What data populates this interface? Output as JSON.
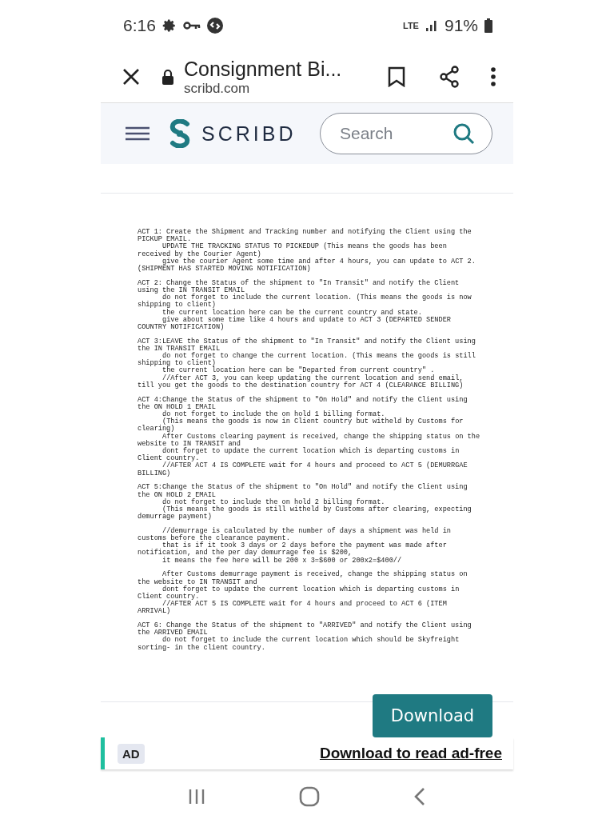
{
  "status_bar": {
    "time": "6:16",
    "network": "LTE",
    "battery": "91%"
  },
  "browser": {
    "title": "Consignment Bi...",
    "url": "scribd.com"
  },
  "site_header": {
    "logo": "SCRIBD",
    "search": {
      "placeholder": "Search"
    }
  },
  "document": {
    "paragraphs": [
      {
        "lines": [
          {
            "text": "ACT 1: Create the Shipment and Tracking number and notifying the Client using the",
            "indent": false
          },
          {
            "text": "PICKUP EMAIL.",
            "indent": false
          },
          {
            "text": "UPDATE THE TRACKING STATUS TO PICKEDUP (This means the goods has been",
            "indent": true
          },
          {
            "text": "received by the Courier Agent)",
            "indent": false
          },
          {
            "text": "give the courier Agent some time and after 4 hours, you can update to ACT 2.",
            "indent": true
          },
          {
            "text": "(SHIPMENT HAS STARTED MOVING NOTIFICATION)",
            "indent": false
          }
        ]
      },
      {
        "lines": [
          {
            "text": "ACT 2: Change the Status of the shipment to \"In Transit\" and notify the Client",
            "indent": false
          },
          {
            "text": "using the IN TRANSIT EMAIL",
            "indent": false
          },
          {
            "text": "do not forget to include the current location. (This means the goods is now",
            "indent": true
          },
          {
            "text": "shipping to client)",
            "indent": false
          },
          {
            "text": "the current location here can be the current country and state.",
            "indent": true
          },
          {
            "text": "give about some time like 4 hours and update to ACT 3 (DEPARTED SENDER",
            "indent": true
          },
          {
            "text": "COUNTRY NOTIFICATION)",
            "indent": false
          }
        ]
      },
      {
        "lines": [
          {
            "text": "ACT 3:LEAVE the Status of the shipment to \"In Transit\" and notify the Client using",
            "indent": false
          },
          {
            "text": "the IN TRANSIT EMAIL",
            "indent": false
          },
          {
            "text": "do not forget to change the current location. (This means the goods is still",
            "indent": true
          },
          {
            "text": "shipping to client)",
            "indent": false
          },
          {
            "text": "the current location here can be \"Departed from current country\" .",
            "indent": true
          },
          {
            "text": "//After ACT 3, you can keep updating the current location and send email,",
            "indent": true
          },
          {
            "text": "till you get the goods to the destination country for ACT 4 (CLEARANCE BILLING)",
            "indent": false
          }
        ]
      },
      {
        "lines": [
          {
            "text": "ACT 4:Change the Status of the shipment to \"On Hold\" and notify the Client using",
            "indent": false
          },
          {
            "text": "the ON HOLD 1 EMAIL",
            "indent": false
          },
          {
            "text": "do not forget to include the on hold 1 billing format.",
            "indent": true
          },
          {
            "text": "(This means the goods is now in Client country but witheld by Customs for",
            "indent": true
          },
          {
            "text": "clearing)",
            "indent": false
          },
          {
            "text": "After Customs clearing payment is received, change the shipping status on the",
            "indent": true
          },
          {
            "text": "website to IN TRANSIT and",
            "indent": false
          },
          {
            "text": "dont forget to update the current location which is departing customs in",
            "indent": true
          },
          {
            "text": "Client country.",
            "indent": false
          },
          {
            "text": "//AFTER ACT 4 IS COMPLETE wait for 4 hours and proceed to ACT 5 (DEMURRGAE",
            "indent": true
          },
          {
            "text": "BILLING)",
            "indent": false
          }
        ]
      },
      {
        "lines": [
          {
            "text": "ACT 5:Change the Status of the shipment to \"On Hold\" and notify the Client using",
            "indent": false
          },
          {
            "text": "the ON HOLD 2 EMAIL",
            "indent": false
          },
          {
            "text": "do not forget to include the on hold 2 billing format.",
            "indent": true
          },
          {
            "text": "(This means the goods is still witheld by Customs after clearing, expecting",
            "indent": true
          },
          {
            "text": "demurrage payment)",
            "indent": false
          }
        ]
      },
      {
        "lines": [
          {
            "text": "//demurrage is calculated by the number of days a shipment was held in",
            "indent": true
          },
          {
            "text": "customs before the clearance payment.",
            "indent": false
          },
          {
            "text": "that is if it took 3 days or 2 days before the payment was made after",
            "indent": true
          },
          {
            "text": "notification, and the per day demurrage fee is $200,",
            "indent": false
          },
          {
            "text": "it means the fee here will be 200 x 3=$600 or 200x2=$400//",
            "indent": true
          }
        ]
      },
      {
        "lines": [
          {
            "text": "After Customs demurrage payment is received, change the shipping status on",
            "indent": true
          },
          {
            "text": "the website to IN TRANSIT and",
            "indent": false
          },
          {
            "text": "dont forget to update the current location which is departing customs in",
            "indent": true
          },
          {
            "text": "Client country.",
            "indent": false
          },
          {
            "text": "//AFTER ACT 5 IS COMPLETE wait for 4 hours and proceed to ACT 6 (ITEM",
            "indent": true
          },
          {
            "text": "ARRIVAL)",
            "indent": false
          }
        ]
      },
      {
        "lines": [
          {
            "text": "ACT 6: Change the Status of the shipment to \"ARRIVED\" and notify the Client using",
            "indent": false
          },
          {
            "text": "the ARRIVED EMAIL",
            "indent": false
          },
          {
            "text": "do not forget to include the current location which should be Skyfreight",
            "indent": true
          },
          {
            "text": "sorting- in the client country.",
            "indent": false
          }
        ]
      }
    ]
  },
  "download_button": "Download",
  "ad_bar": {
    "badge": "AD",
    "link": "Download to read ad-free"
  }
}
